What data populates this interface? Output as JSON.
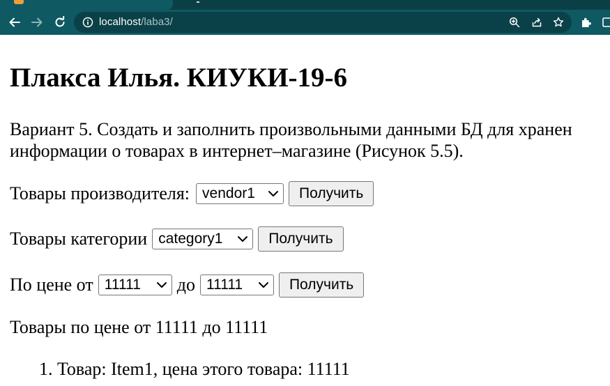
{
  "browser": {
    "url_host": "localhost",
    "url_path": "/laba3/"
  },
  "page": {
    "heading": "Плакса Илья. КИУКИ-19-6",
    "variant_line1": "Вариант 5. Создать и заполнить произвольными данными БД для хранен",
    "variant_line2": "информации о товарах в интернет–магазине (Рисунок 5.5).",
    "vendor_form": {
      "label": "Товары производителя:",
      "selected": "vendor1",
      "button": "Получить"
    },
    "category_form": {
      "label": "Товары категории",
      "selected": "category1",
      "button": "Получить"
    },
    "price_form": {
      "label_from": "По цене от",
      "from_selected": "11111",
      "label_to": "до",
      "to_selected": "11111",
      "button": "Получить"
    },
    "result_title": "Товары по цене от 11111 до 11111",
    "results": [
      {
        "index": "1.",
        "text": "Товар: Item1, цена этого товара: 11111"
      }
    ]
  }
}
